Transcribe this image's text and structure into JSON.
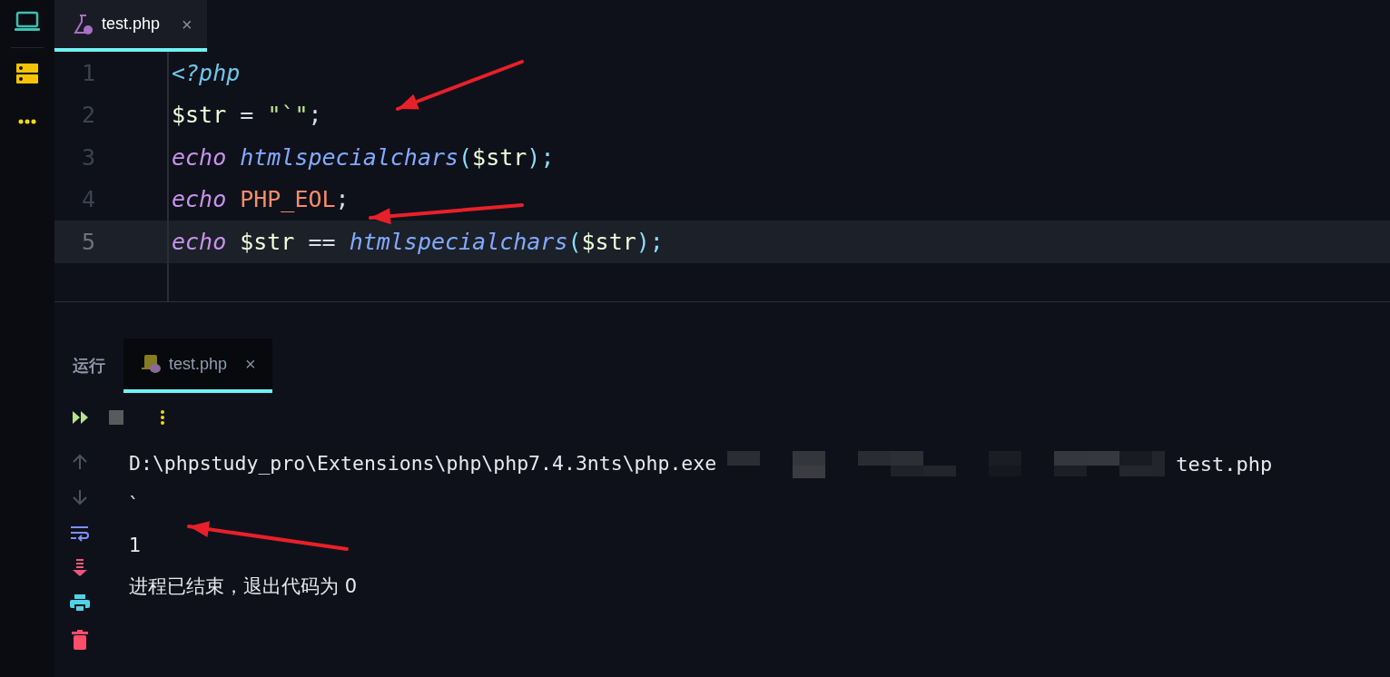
{
  "editor_tab": {
    "label": "test.php",
    "close": "×",
    "selected": true
  },
  "code_lines": [
    {
      "number": "1",
      "current": false,
      "tokens": [
        {
          "text": "<?php",
          "kind": "tag"
        }
      ]
    },
    {
      "number": "2",
      "current": false,
      "tokens": [
        {
          "text": "$str",
          "kind": "var"
        },
        {
          "text": " = ",
          "kind": "op"
        },
        {
          "text": "\"`\"",
          "kind": "string"
        },
        {
          "text": ";",
          "kind": "op"
        }
      ]
    },
    {
      "number": "3",
      "current": false,
      "tokens": [
        {
          "text": "echo",
          "kind": "keyword"
        },
        {
          "text": "htmlspecialchars",
          "kind": "func"
        },
        {
          "text": "(",
          "kind": "paren"
        },
        {
          "text": "$str",
          "kind": "var"
        },
        {
          "text": ");",
          "kind": "paren"
        }
      ]
    },
    {
      "number": "4",
      "current": false,
      "tokens": [
        {
          "text": "echo",
          "kind": "keyword"
        },
        {
          "text": "PHP_EOL",
          "kind": "const"
        },
        {
          "text": ";",
          "kind": "op"
        }
      ]
    },
    {
      "number": "5",
      "current": true,
      "tokens": [
        {
          "text": "echo",
          "kind": "keyword"
        },
        {
          "text": "$str",
          "kind": "var"
        },
        {
          "text": " == ",
          "kind": "op"
        },
        {
          "text": "htmlspecialchars",
          "kind": "func"
        },
        {
          "text": "(",
          "kind": "paren"
        },
        {
          "text": "$str",
          "kind": "var"
        },
        {
          "text": ");",
          "kind": "paren"
        }
      ]
    }
  ],
  "run_panel": {
    "label": "运行",
    "tab": {
      "label": "test.php",
      "close": "×",
      "selected": true
    }
  },
  "output": [
    {
      "kind": "command",
      "path": "D:\\phpstudy_pro\\Extensions\\php\\php7.4.3nts\\php.exe",
      "file": "test.php"
    },
    {
      "kind": "text",
      "text": "`"
    },
    {
      "kind": "text",
      "text": "1"
    },
    {
      "kind": "text",
      "text": "进程已结束，退出代码为 0"
    }
  ]
}
